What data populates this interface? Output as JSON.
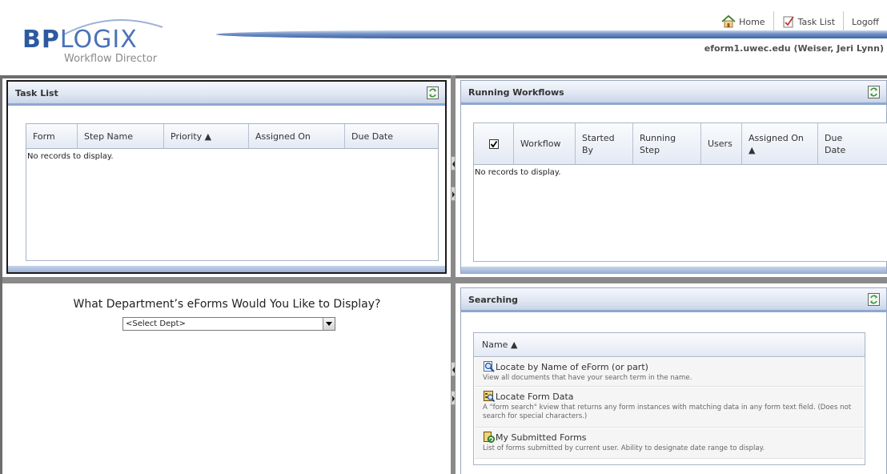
{
  "header": {
    "logo_bp": "BP",
    "logo_logix": "LOGIX",
    "logo_subtitle": "Workflow Director",
    "nav": [
      {
        "label": "Home",
        "icon": "home-icon"
      },
      {
        "label": "Task List",
        "icon": "task-list-icon"
      },
      {
        "label": "Logoff",
        "icon": ""
      }
    ],
    "user_info": "eform1.uwec.edu (Weiser, Jeri Lynn)"
  },
  "task_list": {
    "title": "Task List",
    "columns": [
      "Form",
      "Step Name",
      "Priority ▲",
      "Assigned On",
      "Due Date"
    ],
    "empty_message": "No records to display."
  },
  "running_workflows": {
    "title": "Running Workflows",
    "select_all_checked": true,
    "columns": [
      "Workflow",
      "Started By",
      "Running Step",
      "Users",
      "Assigned On ▲",
      "Due Date"
    ],
    "empty_message": "No records to display."
  },
  "department": {
    "question": "What Department’s eForms Would You Like to Display?",
    "selected": "<Select Dept>"
  },
  "searching": {
    "title": "Searching",
    "column": "Name ▲",
    "items": [
      {
        "title": "Locate by Name of eForm (or part)",
        "description": "View all documents that have your search term in the name.",
        "icon": "magnifier-icon"
      },
      {
        "title": "Locate Form Data",
        "description": "A \"form search\" kview that returns any form instances with matching data in any form text field. (Does not search for special characters.)",
        "icon": "form-search-icon"
      },
      {
        "title": "My Submitted Forms",
        "description": "List of forms submitted by current user. Ability to designate date range to display.",
        "icon": "submitted-forms-icon"
      }
    ]
  },
  "colors": {
    "brand_blue": "#2c5aa0",
    "panel_border": "#8ea7d2",
    "frame": "#6d6d6d"
  }
}
